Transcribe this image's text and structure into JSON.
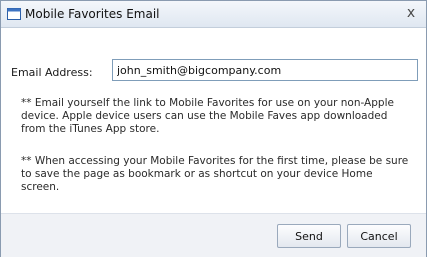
{
  "dialog": {
    "title": "Mobile Favorites Email",
    "close_glyph": "x",
    "window_icon": "window-icon"
  },
  "form": {
    "email_label": "Email Address:",
    "email_value": "john_smith@bigcompany.com"
  },
  "notes": {
    "note1": "** Email yourself the link to Mobile Favorites for use on your non-Apple device. Apple device users can use the Mobile Faves app downloaded from the iTunes App store.",
    "note2": "** When accessing your Mobile Favorites for the first time, please be sure to save the page as bookmark or as shortcut on your device Home screen."
  },
  "buttons": {
    "send_label": "Send",
    "cancel_label": "Cancel"
  },
  "colors": {
    "titlebar_top": "#f4f7fb",
    "titlebar_bottom": "#dfe7f1",
    "border": "#8a9bb0",
    "input_border": "#7f9db9"
  }
}
